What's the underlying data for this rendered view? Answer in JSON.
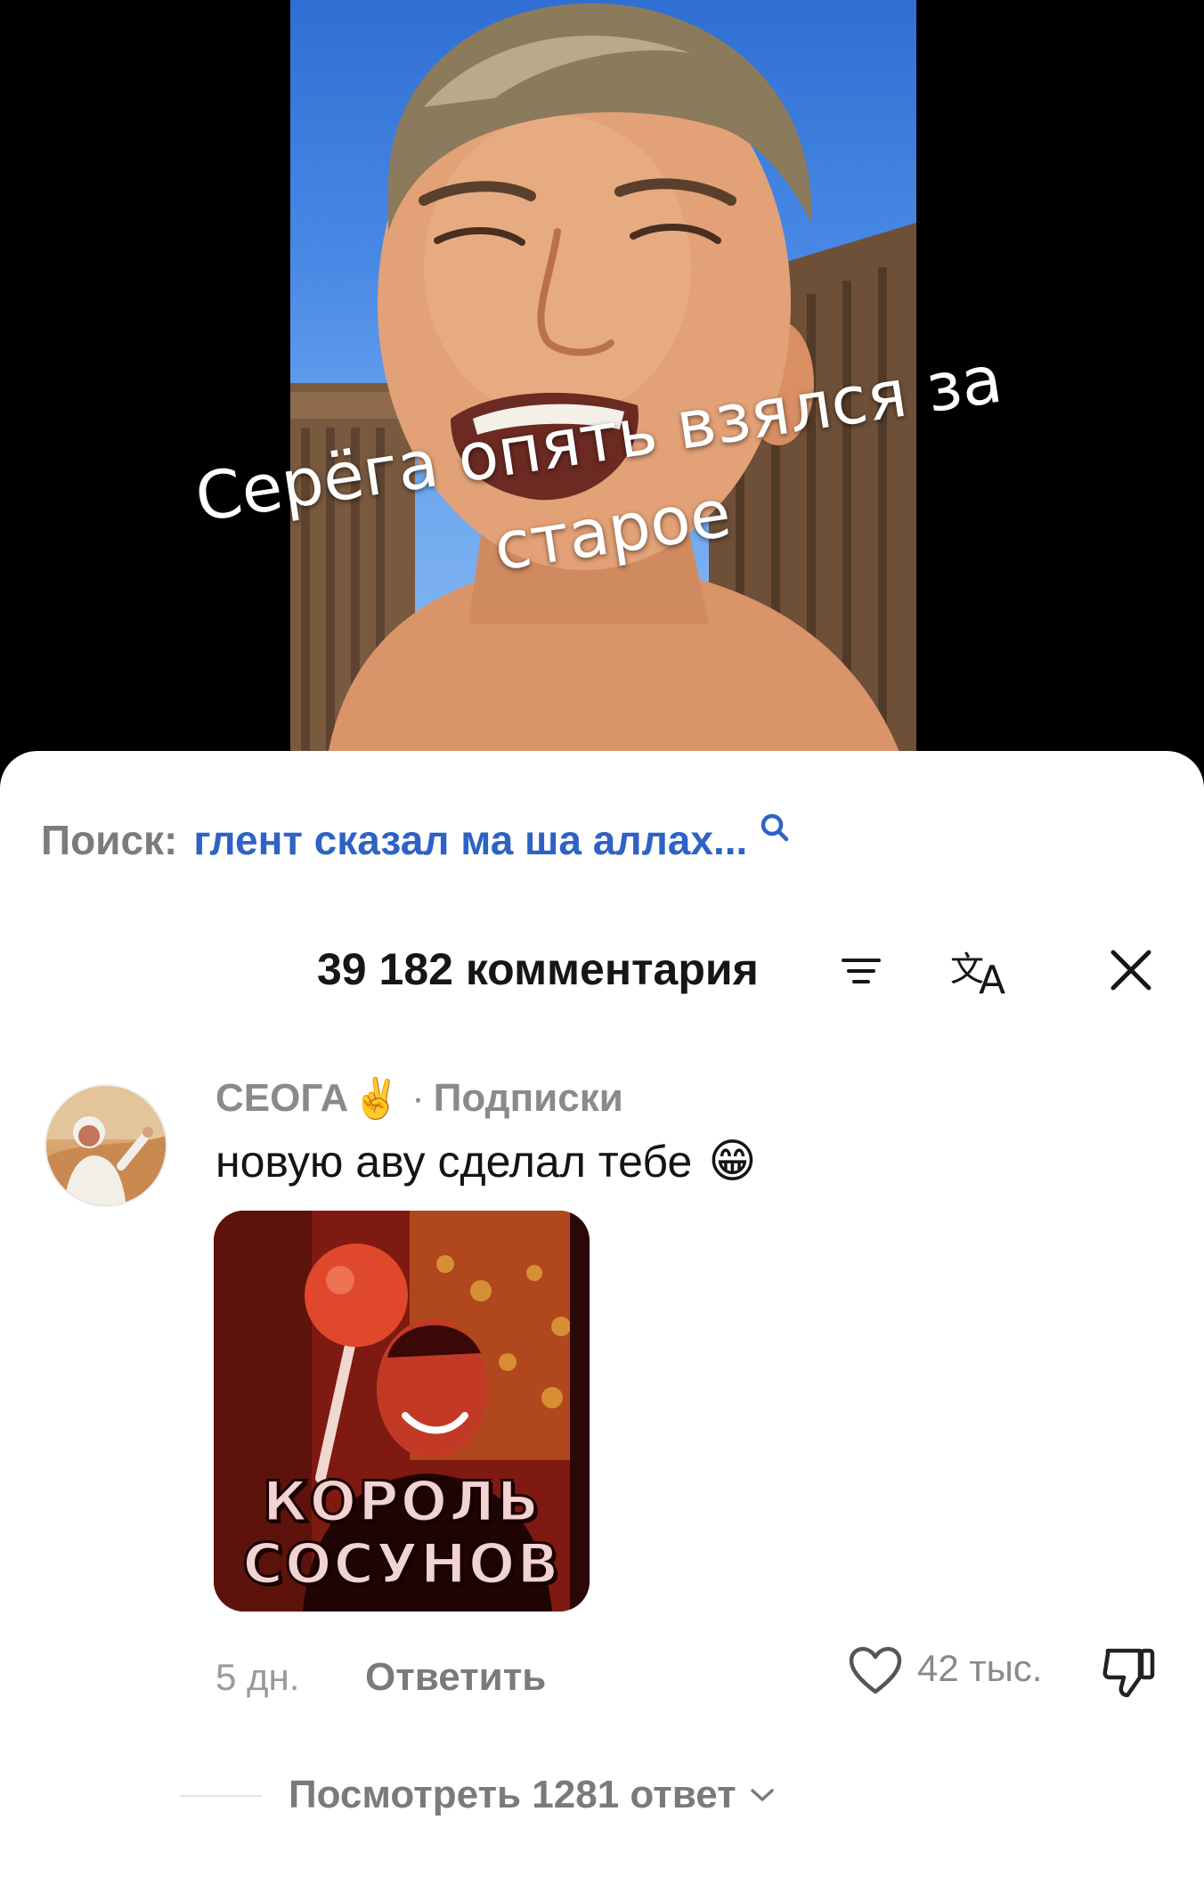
{
  "video": {
    "caption_line1": "Серёга опять взялся за",
    "caption_line2": "старое"
  },
  "search": {
    "prefix": "Поиск:",
    "query": "глент сказал ма ша аллах..."
  },
  "comments_header": {
    "count_label": "39 182 комментария",
    "sort_icon": "sort-icon",
    "translate_icon": "translate-icon",
    "close_icon": "close-icon"
  },
  "comment": {
    "author": "СЕОГА",
    "author_emoji": "✌️",
    "separator": "·",
    "relation": "Подписки",
    "text": "новую аву сделал тебе",
    "text_emoji": "😁",
    "sticker": {
      "line1": "КОРОЛЬ",
      "line2": "СОСУНОВ"
    },
    "time": "5 дн.",
    "reply_label": "Ответить",
    "likes": "42 тыс.",
    "view_replies": "Посмотреть 1281 ответ"
  },
  "colors": {
    "link_blue": "#2e62c5",
    "muted_gray": "#8a8a8a",
    "sheet_bg": "#ffffff"
  }
}
